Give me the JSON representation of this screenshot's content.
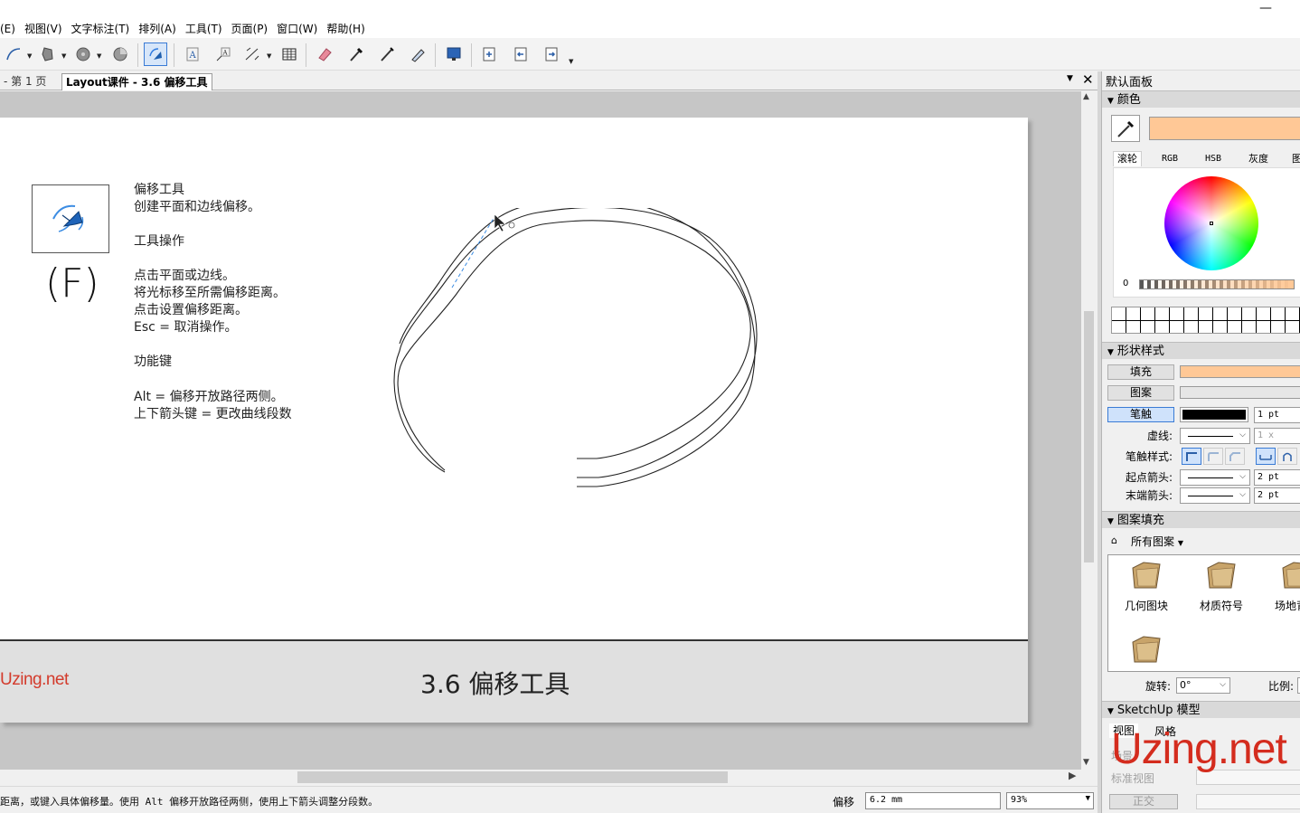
{
  "window": {
    "minimize_glyph": "—"
  },
  "menu": [
    "(E)",
    "视图(V)",
    "文字标注(T)",
    "排列(A)",
    "工具(T)",
    "页面(P)",
    "窗口(W)",
    "帮助(H)"
  ],
  "tabs": {
    "page_tab": "- 第 1 页",
    "document_tab": "Layout课件 - 3.6 偏移工具"
  },
  "page": {
    "shortcut": "(F)",
    "lines": [
      "偏移工具",
      "创建平面和边线偏移。",
      "工具操作",
      "点击平面或边线。",
      "将光标移至所需偏移距离。",
      "点击设置偏移距离。",
      "Esc = 取消操作。",
      "功能键",
      "Alt = 偏移开放路径两侧。",
      "上下箭头键 = 更改曲线段数"
    ],
    "footer_logo": "Uzing.net",
    "footer_title": "3.6 偏移工具"
  },
  "status": {
    "text": "距离，或键入具体偏移量。使用 Alt 偏移开放路径两侧，使用上下箭头调整分段数。",
    "offset_label": "偏移",
    "offset_value": "6.2 mm",
    "zoom": "93%"
  },
  "panel": {
    "title": "默认面板",
    "color": {
      "header": "颜色",
      "current_color": "#ffc896",
      "tabs": [
        "滚轮",
        "RGB",
        "HSB",
        "灰度",
        "图"
      ],
      "opacity_value": "0"
    },
    "shape_style": {
      "header": "形状样式",
      "fill_label": "填充",
      "fill_color": "#ffc896",
      "pattern_label": "图案",
      "stroke_label": "笔触",
      "stroke_width": "1 pt",
      "dash_label": "虚线:",
      "dash_scale": "1 x",
      "stroke_style_label": "笔触样式:",
      "start_arrow_label": "起点箭头:",
      "start_arrow_size": "2 pt",
      "end_arrow_label": "末端箭头:",
      "end_arrow_size": "2 pt"
    },
    "pattern_fill": {
      "header": "图案填充",
      "library": "所有图案",
      "folders": [
        "几何图块",
        "材质符号",
        "场地背景"
      ],
      "rotate_label": "旋转:",
      "rotate_value": "0°",
      "scale_label": "比例:"
    },
    "sketchup": {
      "header": "SketchUp 模型",
      "tabs": [
        "视图",
        "风格"
      ],
      "scene_label": "场景",
      "standard_view_label": "标准视图",
      "ortho_button": "正交",
      "watermark": "Uzing.net"
    }
  }
}
